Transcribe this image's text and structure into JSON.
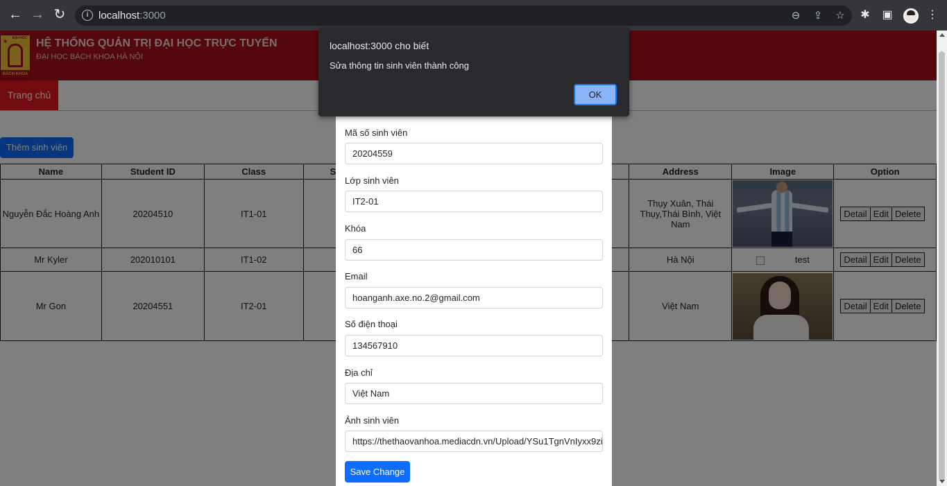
{
  "browser": {
    "url_host": "localhost",
    "url_port": ":3000"
  },
  "header": {
    "title": "HỆ THỐNG QUẢN TRỊ ĐẠI HỌC TRỰC TUYẾN",
    "subtitle": "ĐẠI HỌC BÁCH KHOA HÀ NỘI",
    "logo_top": "ĐẠI HỌC",
    "logo_bottom": "BÁCH KHOA"
  },
  "menu": {
    "home": "Trang chủ"
  },
  "add_button": "Thêm sinh viên",
  "table": {
    "headers": [
      "Name",
      "Student ID",
      "Class",
      "S",
      "Address",
      "Image",
      "Option"
    ],
    "rows": [
      {
        "name": "Nguyễn Đắc Hoàng Anh",
        "id": "20204510",
        "class": "IT1-01",
        "address": "Thụy Xuân, Thái Thụy,Thái Bình, Việt Nam",
        "image": "photo"
      },
      {
        "name": "Mr Kyler",
        "id": "202010101",
        "class": "IT1-02",
        "address": "Hà Nội",
        "image": "test"
      },
      {
        "name": "Mr Gon",
        "id": "20204551",
        "class": "IT2-01",
        "address": "Việt Nam",
        "image": "photo"
      }
    ],
    "options": {
      "detail": "Detail",
      "edit": "Edit",
      "delete": "Delete"
    }
  },
  "modal": {
    "fields": [
      {
        "label": "Mã số sinh viên",
        "value": "20204559"
      },
      {
        "label": "Lớp sinh viên",
        "value": "IT2-01"
      },
      {
        "label": "Khóa",
        "value": "66"
      },
      {
        "label": "Email",
        "value": "hoanganh.axe.no.2@gmail.com"
      },
      {
        "label": "Số điện thoại",
        "value": "134567910"
      },
      {
        "label": "Địa chỉ",
        "value": "Việt Nam"
      },
      {
        "label": "Ảnh sinh viên",
        "value": "https://thethaovanhoa.mediacdn.vn/Upload/YSu1TgnVnIyxx9zi"
      }
    ],
    "save_label": "Save Change"
  },
  "dialog": {
    "title": "localhost:3000 cho biết",
    "message": "Sửa thông tin sinh viên thành công",
    "ok_label": "OK"
  }
}
